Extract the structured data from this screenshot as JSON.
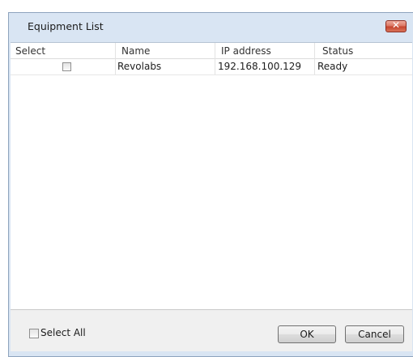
{
  "window": {
    "title": "Equipment List",
    "close_icon": "close-x-icon",
    "close_glyph": "✕"
  },
  "table": {
    "columns": [
      "Select",
      "Name",
      "IP address",
      "Status"
    ],
    "rows": [
      {
        "selected": false,
        "name": "Revolabs",
        "ip": "192.168.100.129",
        "status": "Ready"
      }
    ]
  },
  "footer": {
    "select_all_label": "Select All",
    "select_all_checked": false,
    "ok_label": "OK",
    "cancel_label": "Cancel"
  },
  "colors": {
    "title_bar": "#d9e5f3",
    "close_button": "#c4412b",
    "dialog_body": "#f0f0f0"
  }
}
